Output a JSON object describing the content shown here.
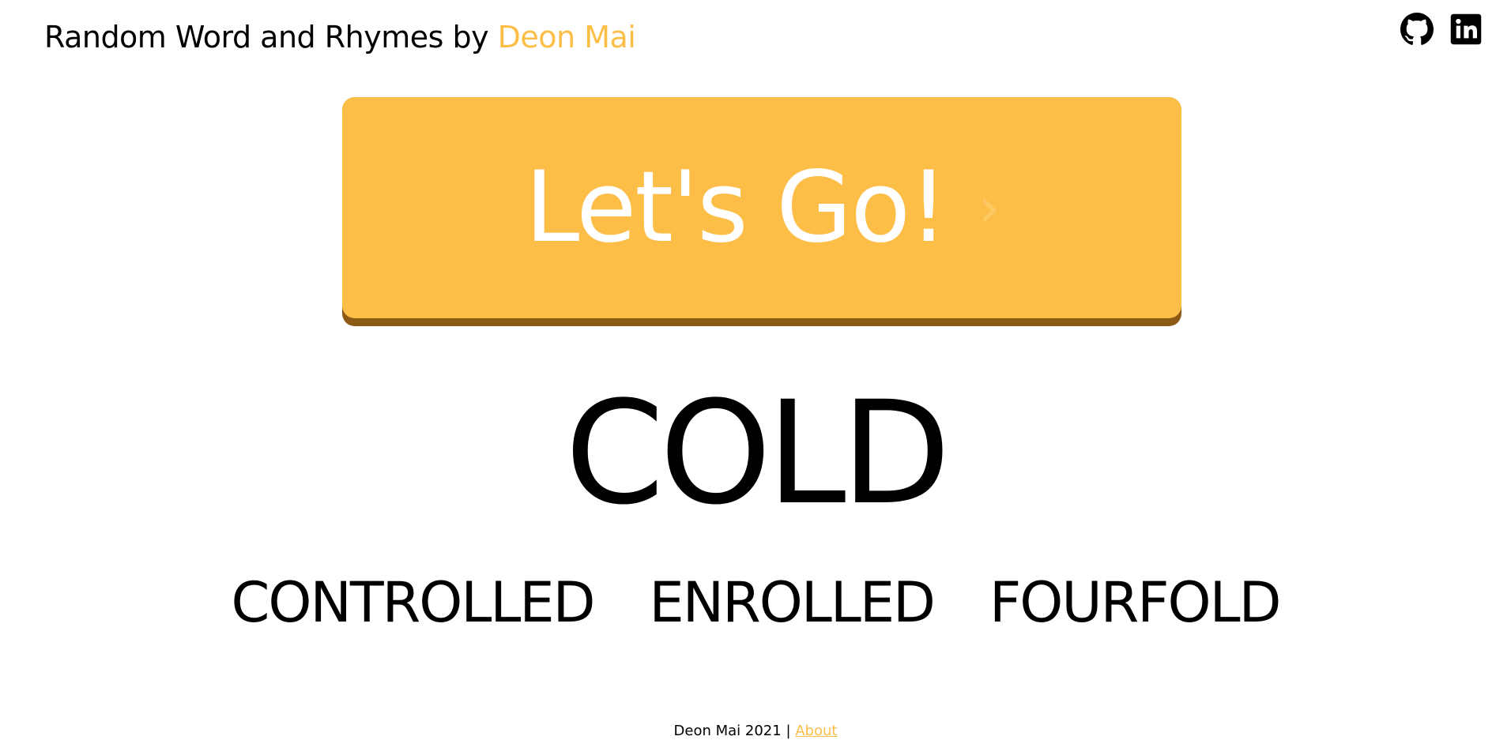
{
  "header": {
    "title_prefix": "Random Word and Rhymes by ",
    "title_author": "Deon Mai",
    "social": [
      {
        "icon": "github-icon"
      },
      {
        "icon": "linkedin-icon"
      }
    ]
  },
  "action": {
    "button_label": "Let's Go!",
    "button_arrow": "›"
  },
  "word": {
    "main": "COLD",
    "rhymes": [
      "CONTROLLED",
      "ENROLLED",
      "FOURFOLD"
    ]
  },
  "footer": {
    "text": "Deon Mai 2021 | ",
    "link_label": "About"
  },
  "colors": {
    "accent": "#fdbe48",
    "button_shadow": "#8b5a14",
    "text": "#000000",
    "background": "#ffffff"
  }
}
